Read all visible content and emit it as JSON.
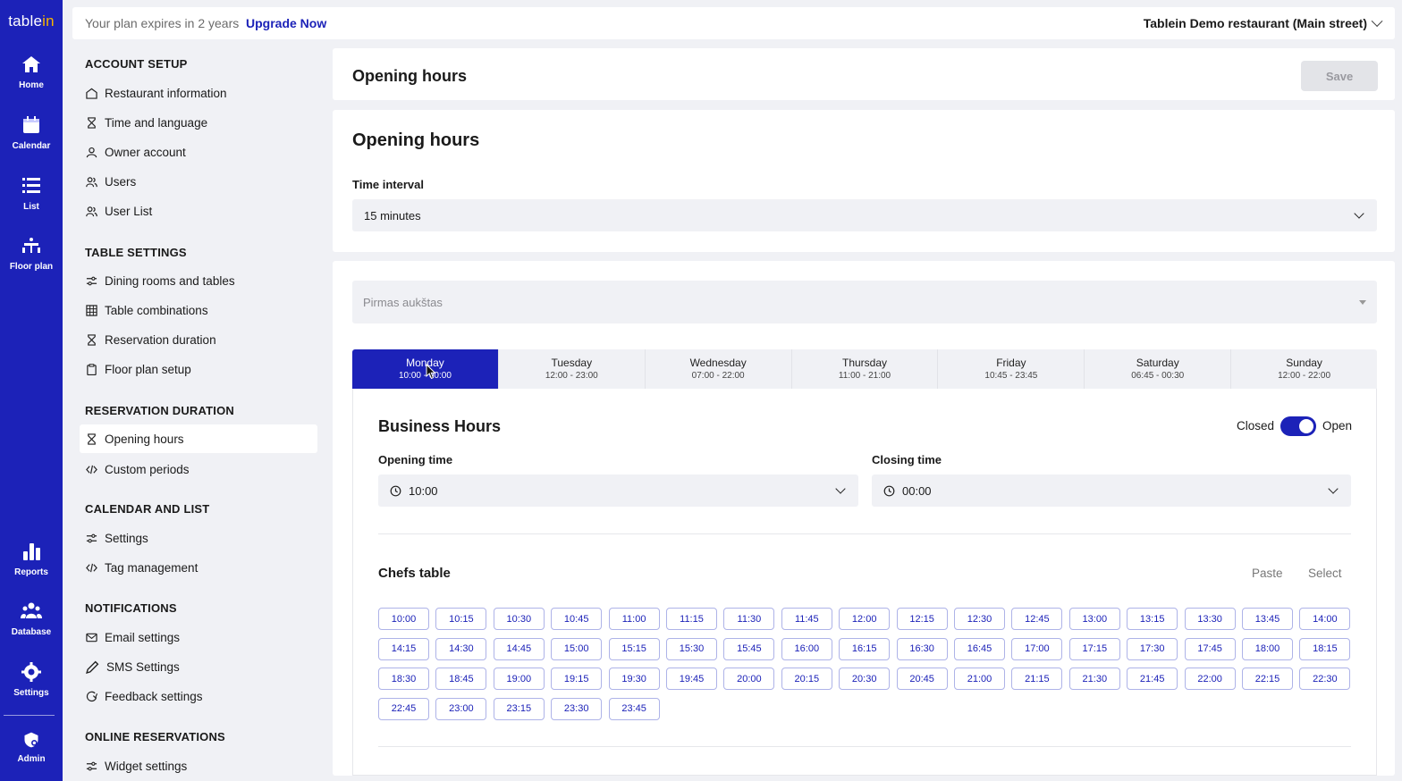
{
  "brand": {
    "name_main": "table",
    "name_accent": "in"
  },
  "rail": {
    "items": [
      {
        "label": "Home",
        "icon": "home-icon"
      },
      {
        "label": "Calendar",
        "icon": "calendar-icon"
      },
      {
        "label": "List",
        "icon": "list-icon"
      },
      {
        "label": "Floor plan",
        "icon": "floor-plan-icon"
      },
      {
        "label": "Reports",
        "icon": "bar-chart-icon"
      },
      {
        "label": "Database",
        "icon": "people-icon"
      },
      {
        "label": "Settings",
        "icon": "gear-icon"
      },
      {
        "label": "Admin",
        "icon": "admin-shield-icon"
      }
    ]
  },
  "topbar": {
    "plan_text": "Your plan expires in 2 years",
    "upgrade": "Upgrade Now",
    "restaurant": "Tablein Demo restaurant (Main street)"
  },
  "sidebar": {
    "sections": [
      {
        "title": "ACCOUNT SETUP",
        "items": [
          "Restaurant information",
          "Time and language",
          "Owner account",
          "Users",
          "User List"
        ]
      },
      {
        "title": "TABLE SETTINGS",
        "items": [
          "Dining rooms and tables",
          "Table combinations",
          "Reservation duration",
          "Floor plan setup"
        ]
      },
      {
        "title": "RESERVATION DURATION",
        "items": [
          "Opening hours",
          "Custom periods"
        ]
      },
      {
        "title": "CALENDAR AND LIST",
        "items": [
          "Settings",
          "Tag management"
        ]
      },
      {
        "title": "NOTIFICATIONS",
        "items": [
          "Email settings",
          "SMS Settings",
          "Feedback settings"
        ]
      },
      {
        "title": "ONLINE RESERVATIONS",
        "items": [
          "Widget settings"
        ]
      }
    ],
    "active_item": "Opening hours"
  },
  "header": {
    "title": "Opening hours",
    "save_label": "Save"
  },
  "opening": {
    "title": "Opening hours",
    "interval_label": "Time interval",
    "interval_value": "15 minutes"
  },
  "room": {
    "placeholder": "Pirmas aukštas"
  },
  "days": [
    {
      "name": "Monday",
      "hours": "10:00 - 00:00"
    },
    {
      "name": "Tuesday",
      "hours": "12:00 - 23:00"
    },
    {
      "name": "Wednesday",
      "hours": "07:00 - 22:00"
    },
    {
      "name": "Thursday",
      "hours": "11:00 - 21:00"
    },
    {
      "name": "Friday",
      "hours": "10:45 - 23:45"
    },
    {
      "name": "Saturday",
      "hours": "06:45 - 00:30"
    },
    {
      "name": "Sunday",
      "hours": "12:00 - 22:00"
    }
  ],
  "business": {
    "title": "Business Hours",
    "closed_label": "Closed",
    "open_label": "Open",
    "opening_label": "Opening time",
    "opening_value": "10:00",
    "closing_label": "Closing time",
    "closing_value": "00:00"
  },
  "table": {
    "name": "Chefs table",
    "paste": "Paste",
    "select": "Select",
    "slots": [
      "10:00",
      "10:15",
      "10:30",
      "10:45",
      "11:00",
      "11:15",
      "11:30",
      "11:45",
      "12:00",
      "12:15",
      "12:30",
      "12:45",
      "13:00",
      "13:15",
      "13:30",
      "13:45",
      "14:00",
      "14:15",
      "14:30",
      "14:45",
      "15:00",
      "15:15",
      "15:30",
      "15:45",
      "16:00",
      "16:15",
      "16:30",
      "16:45",
      "17:00",
      "17:15",
      "17:30",
      "17:45",
      "18:00",
      "18:15",
      "18:30",
      "18:45",
      "19:00",
      "19:15",
      "19:30",
      "19:45",
      "20:00",
      "20:15",
      "20:30",
      "20:45",
      "21:00",
      "21:15",
      "21:30",
      "21:45",
      "22:00",
      "22:15",
      "22:30",
      "22:45",
      "23:00",
      "23:15",
      "23:30",
      "23:45"
    ]
  },
  "colors": {
    "primary": "#1c22b8",
    "accent": "#f5b400",
    "background": "#f0f1f5"
  }
}
